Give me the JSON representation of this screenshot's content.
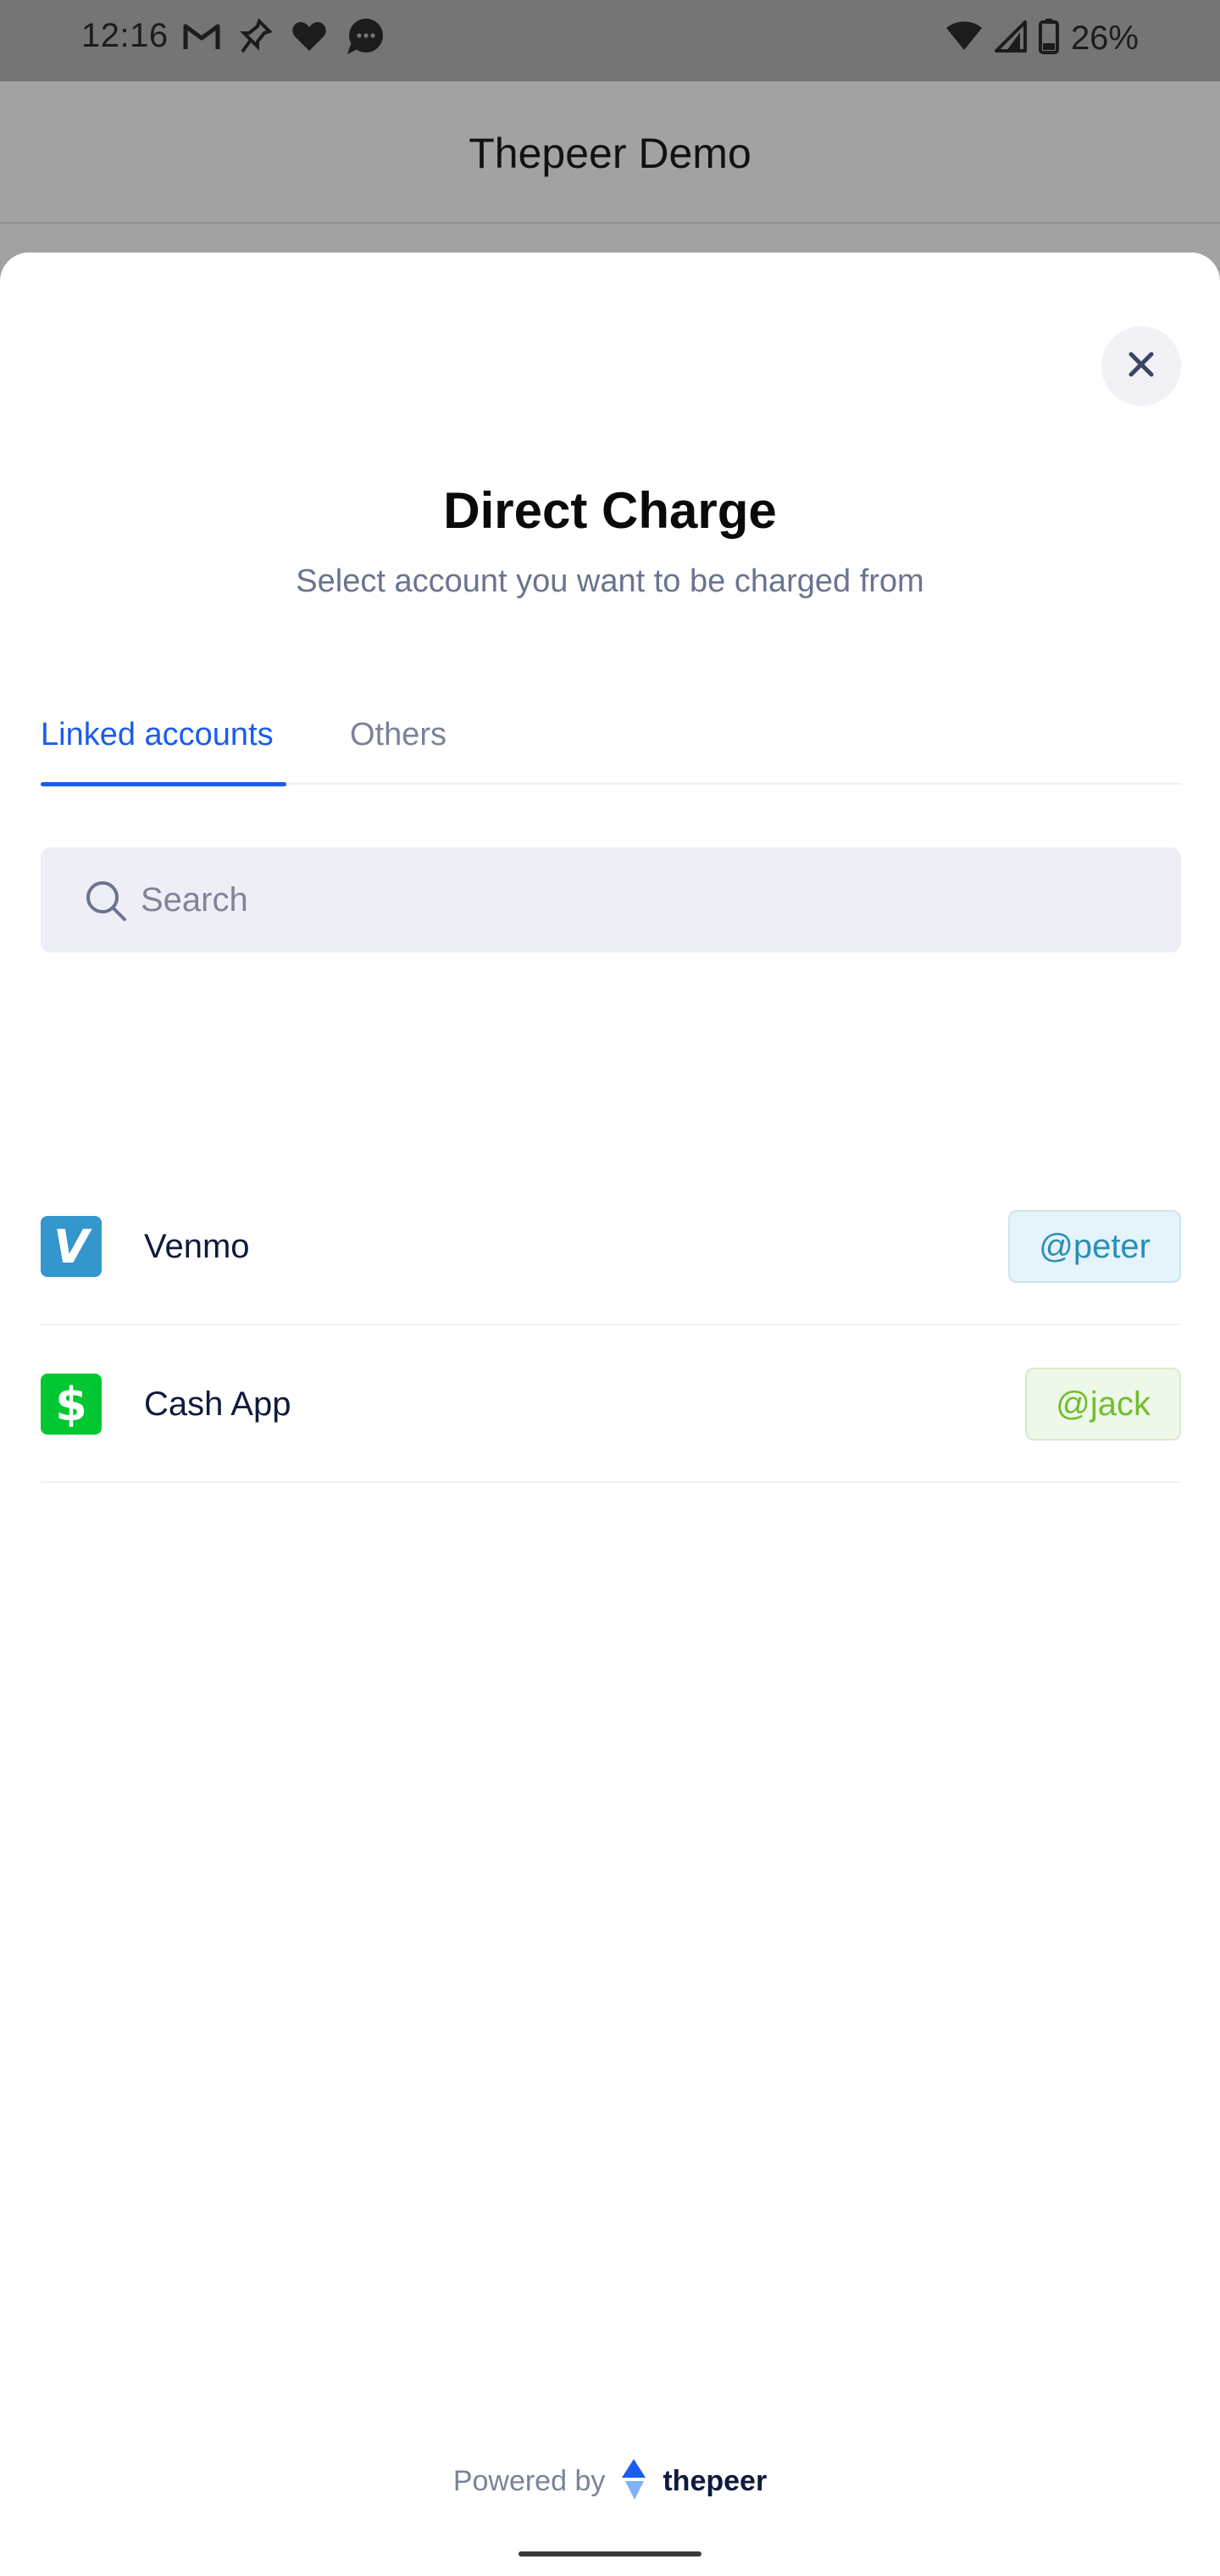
{
  "status_bar": {
    "time": "12:16",
    "battery": "26%",
    "left_icons": [
      "gmail-icon",
      "pin-off-icon",
      "heart-icon",
      "chat-bubble-icon"
    ],
    "right_icons": [
      "wifi-icon",
      "cell-signal-icon",
      "battery-icon"
    ]
  },
  "app_bar": {
    "title": "Thepeer Demo"
  },
  "sheet": {
    "title": "Direct Charge",
    "subtitle": "Select account you want to be charged from",
    "close_icon": "close-icon"
  },
  "tabs": [
    {
      "label": "Linked accounts",
      "active": true
    },
    {
      "label": "Others",
      "active": false
    }
  ],
  "search": {
    "placeholder": "Search",
    "value": ""
  },
  "accounts": [
    {
      "name": "Venmo",
      "handle": "@peter",
      "logo_glyph": "V",
      "color": "#3396cd"
    },
    {
      "name": "Cash App",
      "handle": "@jack",
      "logo_glyph": "$",
      "color": "#00c732"
    }
  ],
  "footer": {
    "powered_by": "Powered by",
    "brand": "thepeer"
  },
  "colors": {
    "accent": "#1a5cf0",
    "venmo": "#3396cd",
    "cashapp": "#00c732"
  }
}
